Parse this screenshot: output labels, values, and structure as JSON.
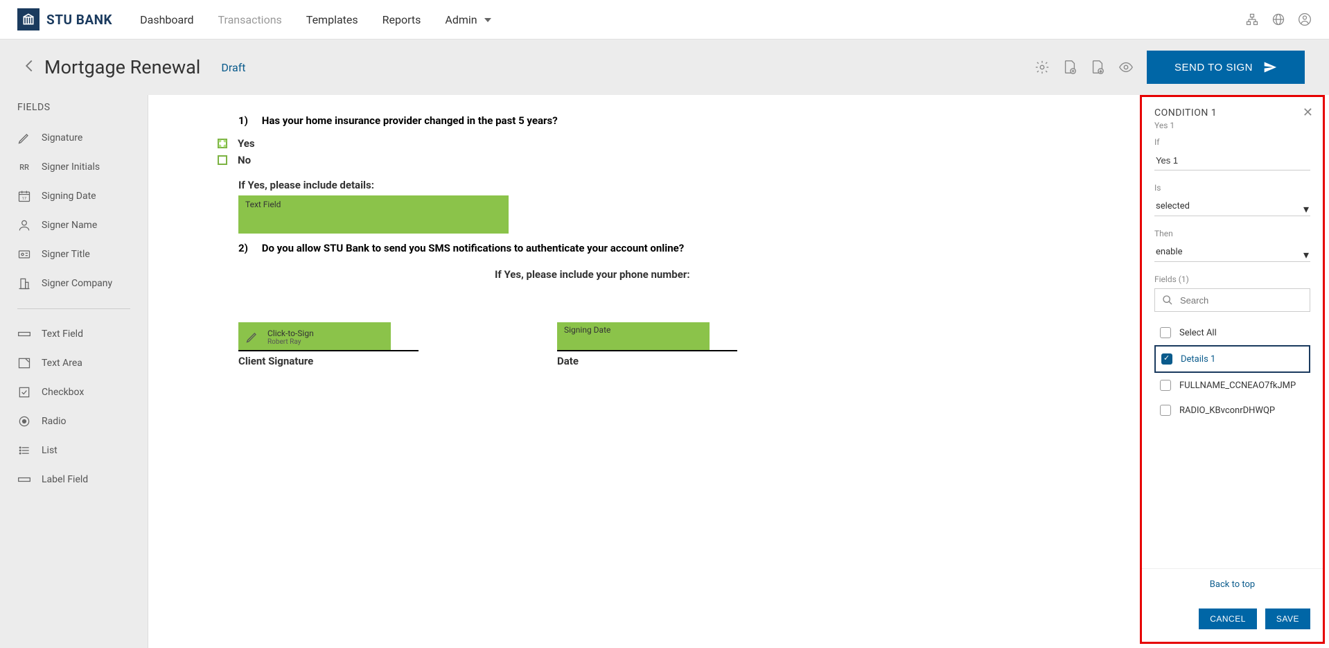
{
  "brand": {
    "name": "STU BANK"
  },
  "nav": {
    "items": [
      {
        "label": "Dashboard",
        "active": true
      },
      {
        "label": "Transactions",
        "active": false
      },
      {
        "label": "Templates",
        "active": true
      },
      {
        "label": "Reports",
        "active": true
      },
      {
        "label": "Admin",
        "active": true,
        "dropdown": true
      }
    ]
  },
  "subheader": {
    "title": "Mortgage Renewal",
    "status": "Draft",
    "send_button": "SEND TO SIGN"
  },
  "sidebar": {
    "title": "FIELDS",
    "group1": [
      {
        "icon": "pen",
        "label": "Signature"
      },
      {
        "icon": "rr",
        "label": "Signer Initials"
      },
      {
        "icon": "calendar",
        "label": "Signing Date"
      },
      {
        "icon": "person",
        "label": "Signer Name"
      },
      {
        "icon": "badge",
        "label": "Signer Title"
      },
      {
        "icon": "building",
        "label": "Signer Company"
      }
    ],
    "group2": [
      {
        "icon": "textfield",
        "label": "Text Field"
      },
      {
        "icon": "textarea",
        "label": "Text Area"
      },
      {
        "icon": "checkbox",
        "label": "Checkbox"
      },
      {
        "icon": "radio",
        "label": "Radio"
      },
      {
        "icon": "list",
        "label": "List"
      },
      {
        "icon": "label",
        "label": "Label Field"
      }
    ]
  },
  "document": {
    "q1_num": "1)",
    "q1_text": "Has your home insurance provider changed in the past 5 years?",
    "opt_yes": "Yes",
    "opt_no": "No",
    "q1_detail_prompt": "If Yes, please include details:",
    "text_field_placeholder": "Text Field",
    "q2_num": "2)",
    "q2_text": "Do you allow STU Bank to send you SMS notifications to authenticate your account online?",
    "q2_detail_prompt": "If Yes, please include your phone number:",
    "sig_click": "Click-to-Sign",
    "sig_name": "Robert Ray",
    "sig_label": "Client Signature",
    "date_field": "Signing Date",
    "date_label": "Date"
  },
  "panel": {
    "title": "CONDITION 1",
    "subtitle": "Yes 1",
    "if_label": "If",
    "if_value": "Yes 1",
    "is_label": "Is",
    "is_value": "selected",
    "then_label": "Then",
    "then_value": "enable",
    "fields_label": "Fields (1)",
    "search_placeholder": "Search",
    "select_all": "Select All",
    "items": [
      {
        "label": "Details 1",
        "checked": true
      },
      {
        "label": "FULLNAME_CCNEAO7fkJMP",
        "checked": false
      },
      {
        "label": "RADIO_KBvconrDHWQP",
        "checked": false
      }
    ],
    "back_to_top": "Back to top",
    "cancel": "CANCEL",
    "save": "SAVE"
  }
}
